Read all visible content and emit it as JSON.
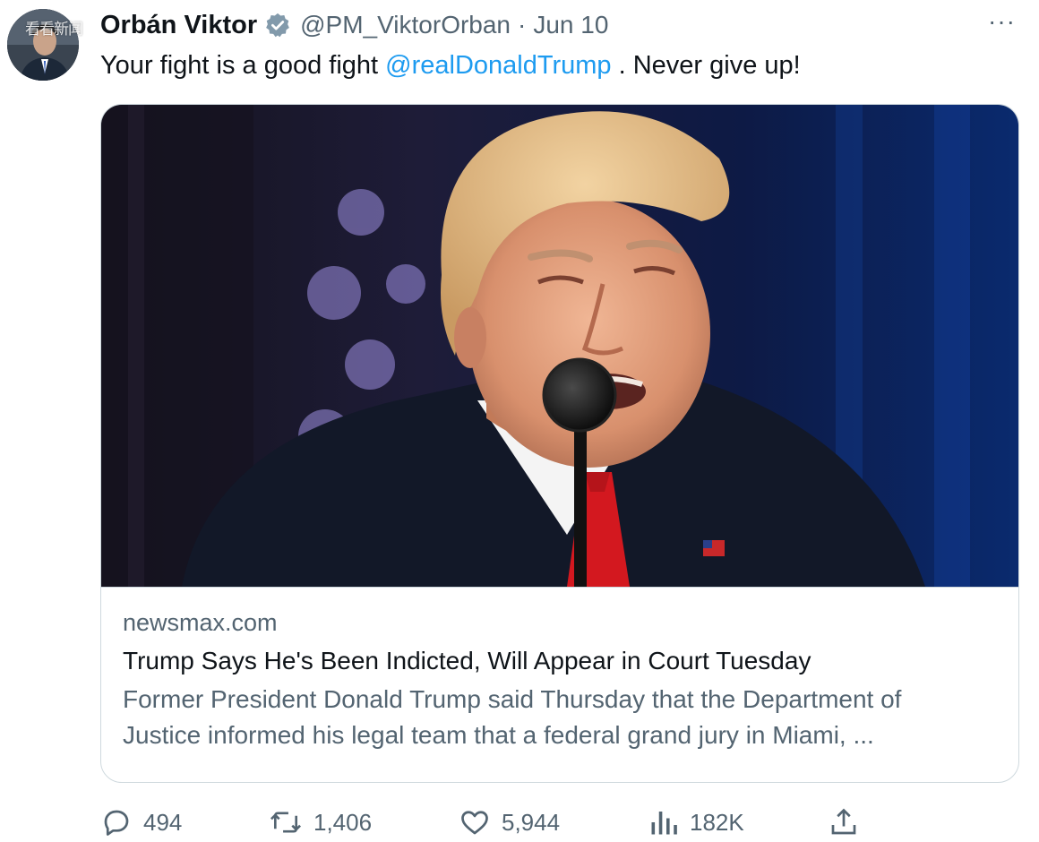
{
  "author": {
    "display_name": "Orbán Viktor",
    "handle": "@PM_ViktorOrban",
    "separator": "·",
    "date": "Jun 10",
    "avatar_icon": "avatar-photo",
    "verified_icon": "verified-badge-icon",
    "watermark": "看看新闻"
  },
  "menu": {
    "more_label": "···"
  },
  "tweet": {
    "text_before": "Your fight is a good fight ",
    "mention": "@realDonaldTrump",
    "text_after": " . Never give up!"
  },
  "card": {
    "domain": "newsmax.com",
    "title": "Trump Says He's Been Indicted, Will Appear in Court Tuesday",
    "description_line1": "Former President Donald Trump said Thursday that the Department of",
    "description_line2": "Justice informed his legal team that a federal grand jury in Miami, ..."
  },
  "actions": {
    "reply_count": "494",
    "retweet_count": "1,406",
    "like_count": "5,944",
    "views_count": "182K",
    "reply_icon": "reply-icon",
    "retweet_icon": "retweet-icon",
    "like_icon": "heart-icon",
    "views_icon": "views-icon",
    "share_icon": "share-icon"
  },
  "colors": {
    "link": "#1d9bf0",
    "muted": "#536471",
    "text": "#0f1419",
    "border": "#cfd9de"
  }
}
